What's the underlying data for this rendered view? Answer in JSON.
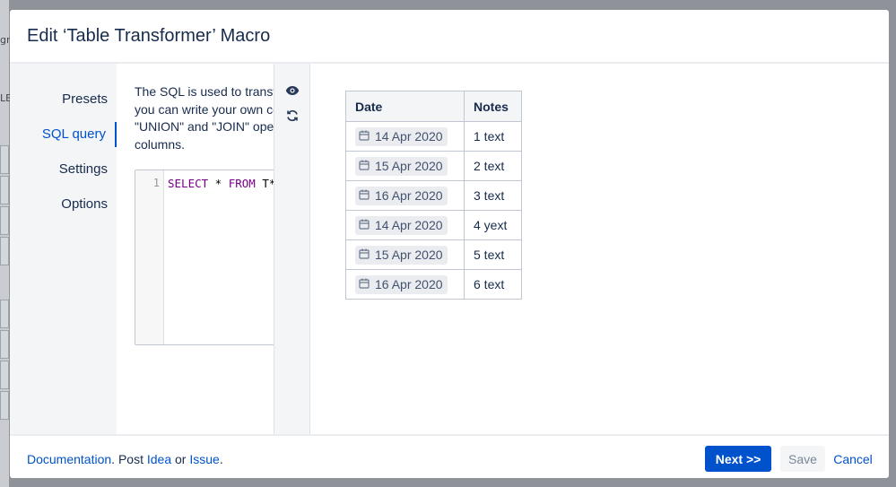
{
  "background": {
    "fragments": [
      "gr",
      "LE"
    ]
  },
  "dialog": {
    "title": "Edit ‘Table Transformer’ Macro"
  },
  "nav": {
    "items": [
      {
        "label": "Presets",
        "active": false
      },
      {
        "label": "SQL query",
        "active": true
      },
      {
        "label": "Settings",
        "active": false
      },
      {
        "label": "Options",
        "active": false
      }
    ]
  },
  "sql": {
    "description_lines": [
      "The SQL is used to transfo",
      "you can write your own co",
      "\"UNION\" and \"JOIN\" oper",
      "columns."
    ],
    "line_number": "1",
    "code_keyword_1": "SELECT",
    "code_middle": " * ",
    "code_keyword_2": "FROM",
    "code_tail": " T*"
  },
  "toolbar": {
    "icons": [
      "eye-icon",
      "refresh-icon"
    ]
  },
  "preview_table": {
    "headers": [
      "Date",
      "Notes"
    ],
    "rows": [
      {
        "date": "14 Apr 2020",
        "notes": "1 text"
      },
      {
        "date": "15 Apr 2020",
        "notes": "2 text"
      },
      {
        "date": "16 Apr 2020",
        "notes": "3 text"
      },
      {
        "date": "14 Apr 2020",
        "notes": "4 yext"
      },
      {
        "date": "15 Apr 2020",
        "notes": "5 text"
      },
      {
        "date": "16 Apr 2020",
        "notes": "6 text"
      }
    ]
  },
  "footer": {
    "documentation_link": "Documentation",
    "sep1": ". Post ",
    "idea_link": "Idea",
    "sep2": " or ",
    "issue_link": "Issue",
    "sep3": ".",
    "next_label": "Next >>",
    "save_label": "Save",
    "cancel_label": "Cancel"
  },
  "colors": {
    "primary": "#0052cc",
    "text": "#172b4d",
    "nav_bg": "#f4f5f7",
    "overlay": "#8f9399"
  }
}
